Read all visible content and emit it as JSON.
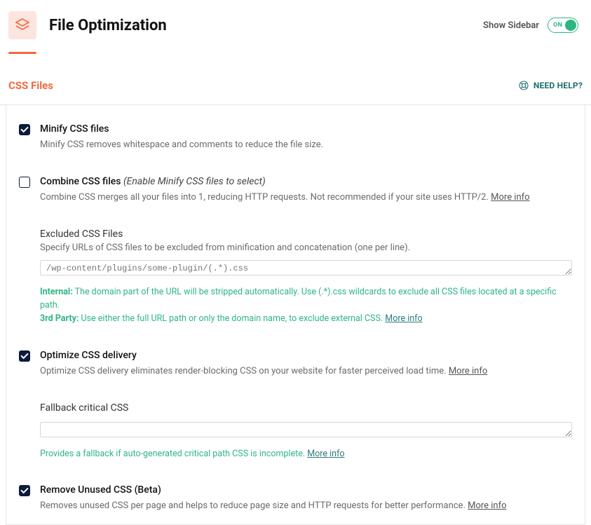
{
  "header": {
    "title": "File Optimization",
    "sidebar_label": "Show Sidebar",
    "toggle_state": "ON"
  },
  "section": {
    "title": "CSS Files",
    "help_label": "NEED HELP?"
  },
  "options": {
    "minify": {
      "title": "Minify CSS files",
      "desc": "Minify CSS removes whitespace and comments to reduce the file size."
    },
    "combine": {
      "title_main": "Combine CSS files ",
      "title_em": "(Enable Minify CSS files to select)",
      "desc": "Combine CSS merges all your files into 1, reducing HTTP requests. Not recommended if your site uses HTTP/2. ",
      "more": "More info"
    },
    "excluded": {
      "title": "Excluded CSS Files",
      "desc": "Specify URLs of CSS files to be excluded from minification and concatenation (one per line).",
      "placeholder": "/wp-content/plugins/some-plugin/(.*).css",
      "hint_internal_label": "Internal:",
      "hint_internal": " The domain part of the URL will be stripped automatically. Use (.*).css wildcards to exclude all CSS files located at a specific path.",
      "hint_3rd_label": "3rd Party:",
      "hint_3rd": " Use either the full URL path or only the domain name, to exclude external CSS. ",
      "more": "More info"
    },
    "optimize": {
      "title": "Optimize CSS delivery",
      "desc": "Optimize CSS delivery eliminates render-blocking CSS on your website for faster perceived load time. ",
      "more": "More info"
    },
    "fallback": {
      "title": "Fallback critical CSS",
      "hint": "Provides a fallback if auto-generated critical path CSS is incomplete. ",
      "more": "More info"
    },
    "unused": {
      "title": "Remove Unused CSS (Beta)",
      "desc": "Removes unused CSS per page and helps to reduce page size and HTTP requests for better performance. ",
      "more": "More info"
    }
  }
}
